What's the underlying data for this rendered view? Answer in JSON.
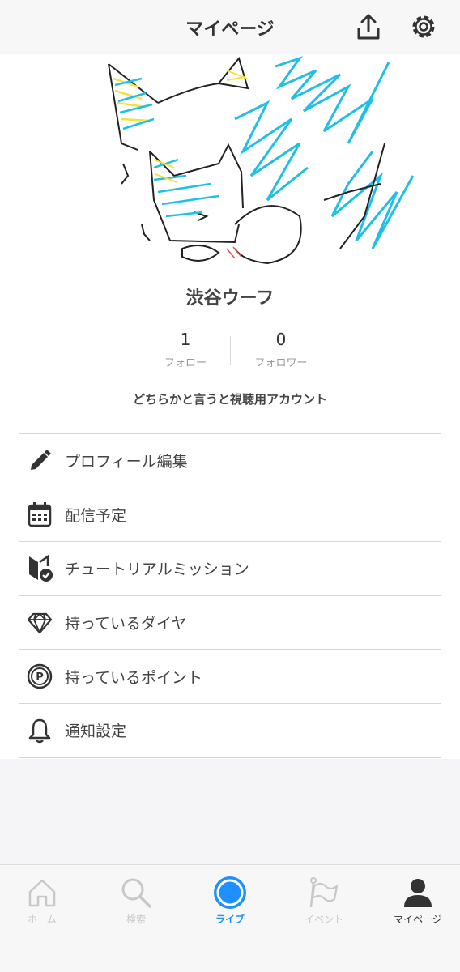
{
  "header": {
    "title": "マイページ",
    "share_icon": "share-icon",
    "settings_icon": "gear-icon"
  },
  "profile": {
    "name": "渋谷ウーフ",
    "follow_count": "1",
    "follow_label": "フォロー",
    "follower_count": "0",
    "follower_label": "フォロワー",
    "bio": "どちらかと言うと視聴用アカウント",
    "avatar_icon": "cat-drawing-avatar"
  },
  "menu": {
    "items": [
      {
        "label": "プロフィール編集",
        "icon": "pencil-icon"
      },
      {
        "label": "配信予定",
        "icon": "calendar-icon"
      },
      {
        "label": "チュートリアルミッション",
        "icon": "beginner-badge-icon"
      },
      {
        "label": "持っているダイヤ",
        "icon": "diamond-icon"
      },
      {
        "label": "持っているポイント",
        "icon": "point-icon"
      },
      {
        "label": "通知設定",
        "icon": "bell-icon"
      }
    ]
  },
  "tabbar": {
    "tabs": [
      {
        "label": "ホーム",
        "icon": "home-icon",
        "color": "#c8c8cc"
      },
      {
        "label": "検索",
        "icon": "search-icon",
        "color": "#c8c8cc"
      },
      {
        "label": "ライブ",
        "icon": "live-icon",
        "color": "#1e90ff"
      },
      {
        "label": "イベント",
        "icon": "flag-icon",
        "color": "#c8c8cc"
      },
      {
        "label": "マイページ",
        "icon": "person-icon",
        "color": "#333333"
      }
    ]
  },
  "colors": {
    "accent": "#1e90ff",
    "drawing_cyan": "#1fc0e6",
    "drawing_yellow": "#f3e23a"
  }
}
